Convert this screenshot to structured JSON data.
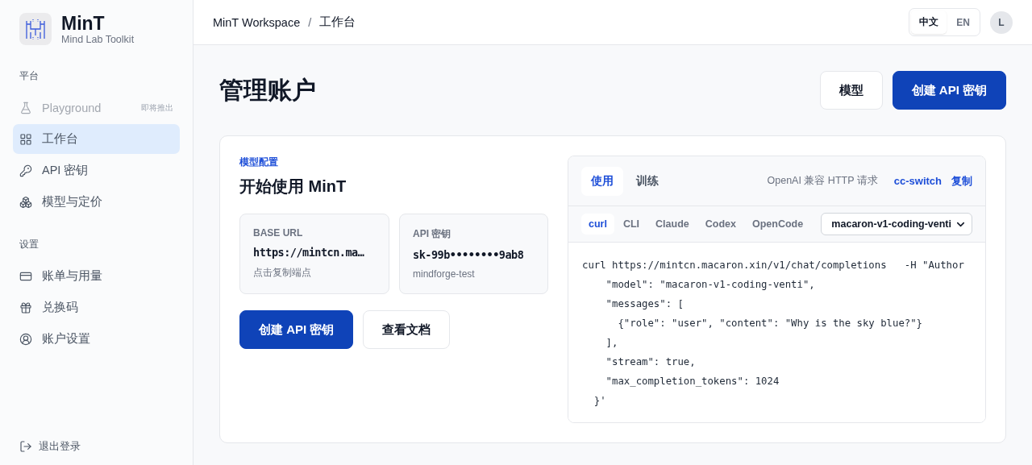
{
  "brand": {
    "name": "MinT",
    "subtitle": "Mind Lab Toolkit"
  },
  "sidebar": {
    "sections": [
      {
        "title": "平台",
        "items": [
          {
            "label": "Playground",
            "selected": false,
            "disabled": true,
            "badge": "即将推出"
          },
          {
            "label": "工作台",
            "selected": true,
            "disabled": false
          },
          {
            "label": "API 密钥",
            "selected": false,
            "disabled": false
          },
          {
            "label": "模型与定价",
            "selected": false,
            "disabled": false
          }
        ]
      },
      {
        "title": "设置",
        "items": [
          {
            "label": "账单与用量",
            "selected": false,
            "disabled": false
          },
          {
            "label": "兑换码",
            "selected": false,
            "disabled": false
          },
          {
            "label": "账户设置",
            "selected": false,
            "disabled": false
          }
        ]
      }
    ],
    "logout": "退出登录"
  },
  "header": {
    "breadcrumb": [
      "MinT Workspace",
      "工作台"
    ],
    "separator": "/",
    "languages": [
      {
        "label": "中文",
        "selected": true
      },
      {
        "label": "EN",
        "selected": false
      }
    ],
    "avatar": "L"
  },
  "page": {
    "title": "管理账户",
    "buttons": [
      {
        "label": "模型",
        "kind": "secondary"
      },
      {
        "label": "创建 API 密钥",
        "kind": "primary"
      }
    ]
  },
  "card": {
    "eyebrow": "模型配置",
    "title": "开始使用 MinT",
    "infos": [
      {
        "label": "BASE URL",
        "value": "https://mintcn.ma…",
        "hint": "点击复制端点"
      },
      {
        "label": "API 密钥",
        "value": "sk-99b••••••••9ab8",
        "hint": "mindforge-test"
      }
    ],
    "buttons": [
      {
        "label": "创建 API 密钥",
        "kind": "primary"
      },
      {
        "label": "查看文档",
        "kind": "secondary"
      }
    ]
  },
  "code_panel": {
    "tabs": [
      {
        "label": "使用",
        "selected": true
      },
      {
        "label": "训练",
        "selected": false
      }
    ],
    "note": "OpenAI 兼容 HTTP 请求",
    "links": [
      "cc-switch",
      "复制"
    ],
    "clients": [
      {
        "label": "curl",
        "selected": true
      },
      {
        "label": "CLI",
        "selected": false
      },
      {
        "label": "Claude",
        "selected": false
      },
      {
        "label": "Codex",
        "selected": false
      },
      {
        "label": "OpenCode",
        "selected": false
      }
    ],
    "model": "macaron-v1-coding-venti",
    "code": [
      "curl https://mintcn.macaron.xin/v1/chat/completions   -H \"Author",
      "    \"model\": \"macaron-v1-coding-venti\",",
      "    \"messages\": [",
      "      {\"role\": \"user\", \"content\": \"Why is the sky blue?\"}",
      "    ],",
      "    \"stream\": true,",
      "    \"max_completion_tokens\": 1024",
      "  }'"
    ]
  }
}
